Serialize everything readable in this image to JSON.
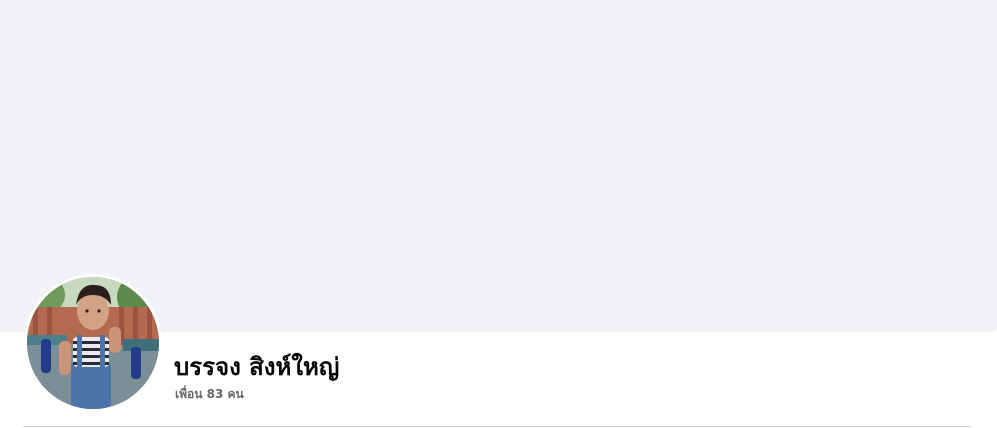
{
  "profile": {
    "name": "บรรจง สิงห์ใหญ่",
    "friends_text": "เพื่อน 83 คน"
  },
  "colors": {
    "cover_background": "#f0f2f5",
    "name_text": "#050505",
    "secondary_text": "#65676b",
    "divider": "#ced0d4"
  }
}
